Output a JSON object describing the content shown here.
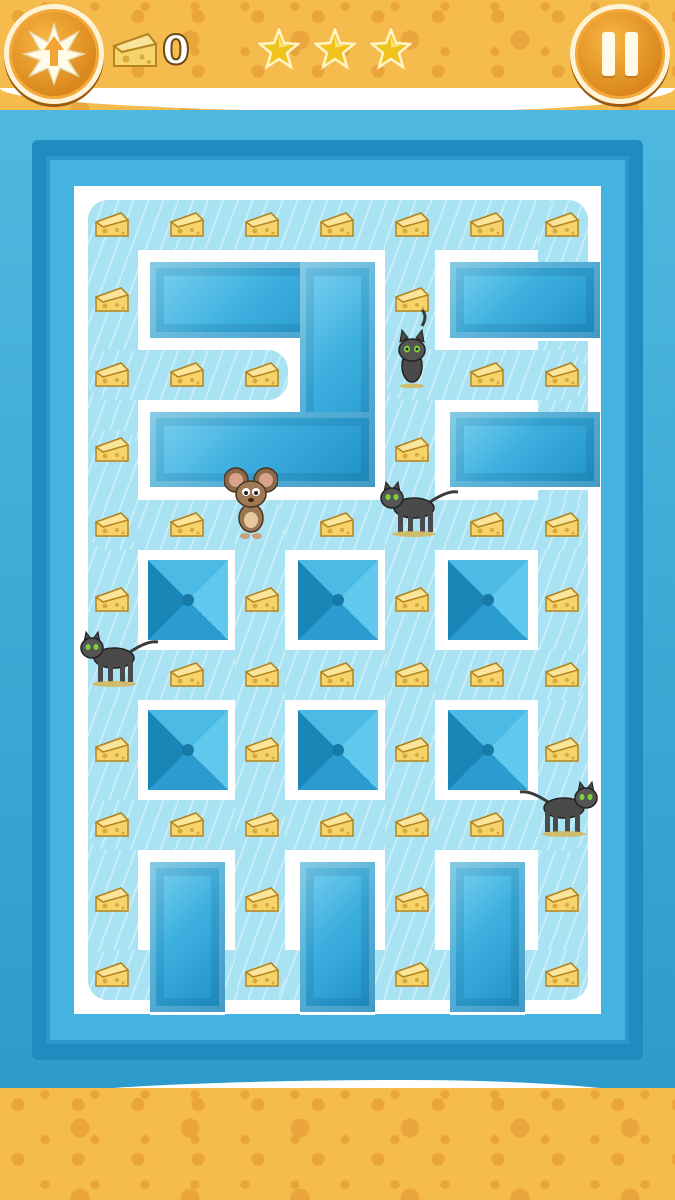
{
  "hud": {
    "menu_icon": "star-burst-arrow-icon",
    "cheese_icon": "cheese-icon",
    "cheese_count": "0",
    "stars_earned": 3,
    "stars_total": 3,
    "star_icon": "star-icon",
    "pause_icon": "pause-icon"
  },
  "colors": {
    "cheese_bar": "#f6bb4d",
    "button_orange": "#e89628",
    "maze_blue": "#3eb0e0",
    "ice": "#a9e3f3",
    "star": "#f2c21f"
  },
  "characters": {
    "mouse": "mouse",
    "cats": [
      "cat",
      "cat",
      "cat",
      "cat"
    ]
  }
}
